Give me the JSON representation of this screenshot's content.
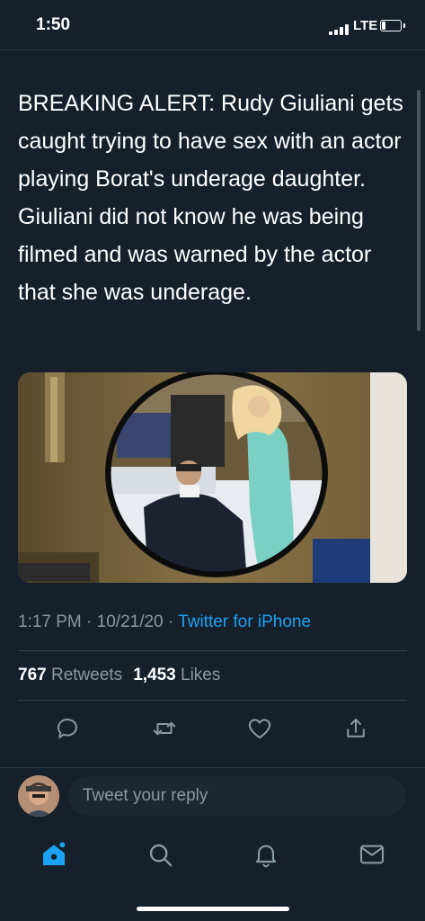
{
  "status_bar": {
    "time": "1:50",
    "network": "LTE",
    "icons": [
      "signal-icon",
      "battery-icon"
    ]
  },
  "tweet": {
    "text": "BREAKING ALERT: Rudy Giuliani gets caught trying to have sex with an actor playing Borat's underage daughter. Giuliani did not know he was being filmed and was warned by the actor that she was underage.",
    "media": {
      "type": "video-still"
    },
    "time": "1:17 PM",
    "date": "10/21/20",
    "separator": "·",
    "source": "Twitter for iPhone",
    "retweets_count": "767",
    "retweets_label": "Retweets",
    "likes_count": "1,453",
    "likes_label": "Likes"
  },
  "actions": {
    "icons": [
      "reply-icon",
      "retweet-icon",
      "like-icon",
      "share-icon"
    ],
    "color": "#8899a6"
  },
  "composer": {
    "placeholder": "Tweet your reply"
  },
  "tab_bar": {
    "icons": [
      "home-icon",
      "search-icon",
      "notifications-icon",
      "messages-icon"
    ],
    "active": "home-icon"
  },
  "colors": {
    "background": "#15202b",
    "accent": "#1da1f2",
    "secondary_text": "#8899a6"
  }
}
